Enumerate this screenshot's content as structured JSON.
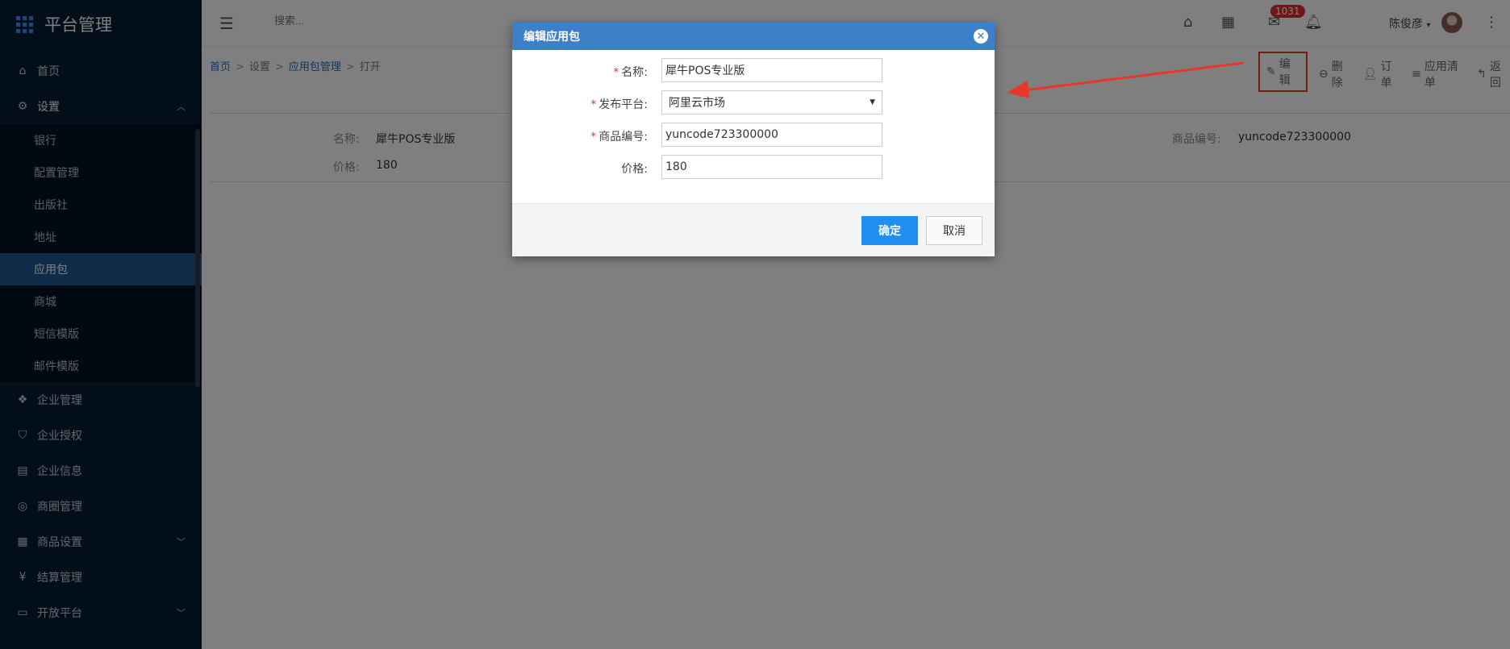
{
  "brand": {
    "title": "平台管理"
  },
  "sidebar": {
    "items": [
      {
        "label": "首页",
        "icon": "home-icon"
      },
      {
        "label": "设置",
        "icon": "gear-icon"
      },
      {
        "label": "企业管理",
        "icon": "building-icon"
      },
      {
        "label": "企业授权",
        "icon": "shield-icon"
      },
      {
        "label": "企业信息",
        "icon": "info-card-icon"
      },
      {
        "label": "商圈管理",
        "icon": "compass-icon"
      },
      {
        "label": "商品设置",
        "icon": "grid-icon"
      },
      {
        "label": "结算管理",
        "icon": "yen-icon"
      },
      {
        "label": "开放平台",
        "icon": "card-icon"
      }
    ],
    "settings_sub": [
      "银行",
      "配置管理",
      "出版社",
      "地址",
      "应用包",
      "商城",
      "短信模版",
      "邮件模版"
    ]
  },
  "header": {
    "search_placeholder": "搜索...",
    "badge_count": "1031",
    "user_name": "陈俊彦"
  },
  "breadcrumb": {
    "home": "首页",
    "settings": "设置",
    "app_pkg": "应用包管理",
    "current": "打开"
  },
  "actions": {
    "edit": "编辑",
    "delete": "删除",
    "order": "订单",
    "app_list": "应用清单",
    "back": "返回"
  },
  "detail": {
    "name_label": "名称:",
    "name_value": "犀牛POS专业版",
    "price_label": "价格:",
    "price_value": "180",
    "sku_label": "商品编号:",
    "sku_value": "yuncode723300000"
  },
  "modal": {
    "title": "编辑应用包",
    "name_label": "名称:",
    "name_value": "犀牛POS专业版",
    "platform_label": "发布平台:",
    "platform_value": "阿里云市场",
    "sku_label": "商品编号:",
    "sku_value": "yuncode723300000",
    "price_label": "价格:",
    "price_value": "180",
    "ok_label": "确定",
    "cancel_label": "取消"
  },
  "colors": {
    "sidebar_bg": "#041d35",
    "active_item": "#1f5a91",
    "modal_header": "#3b80c8",
    "primary_button": "#1e8ff0",
    "annotation_red": "#e8372a"
  }
}
